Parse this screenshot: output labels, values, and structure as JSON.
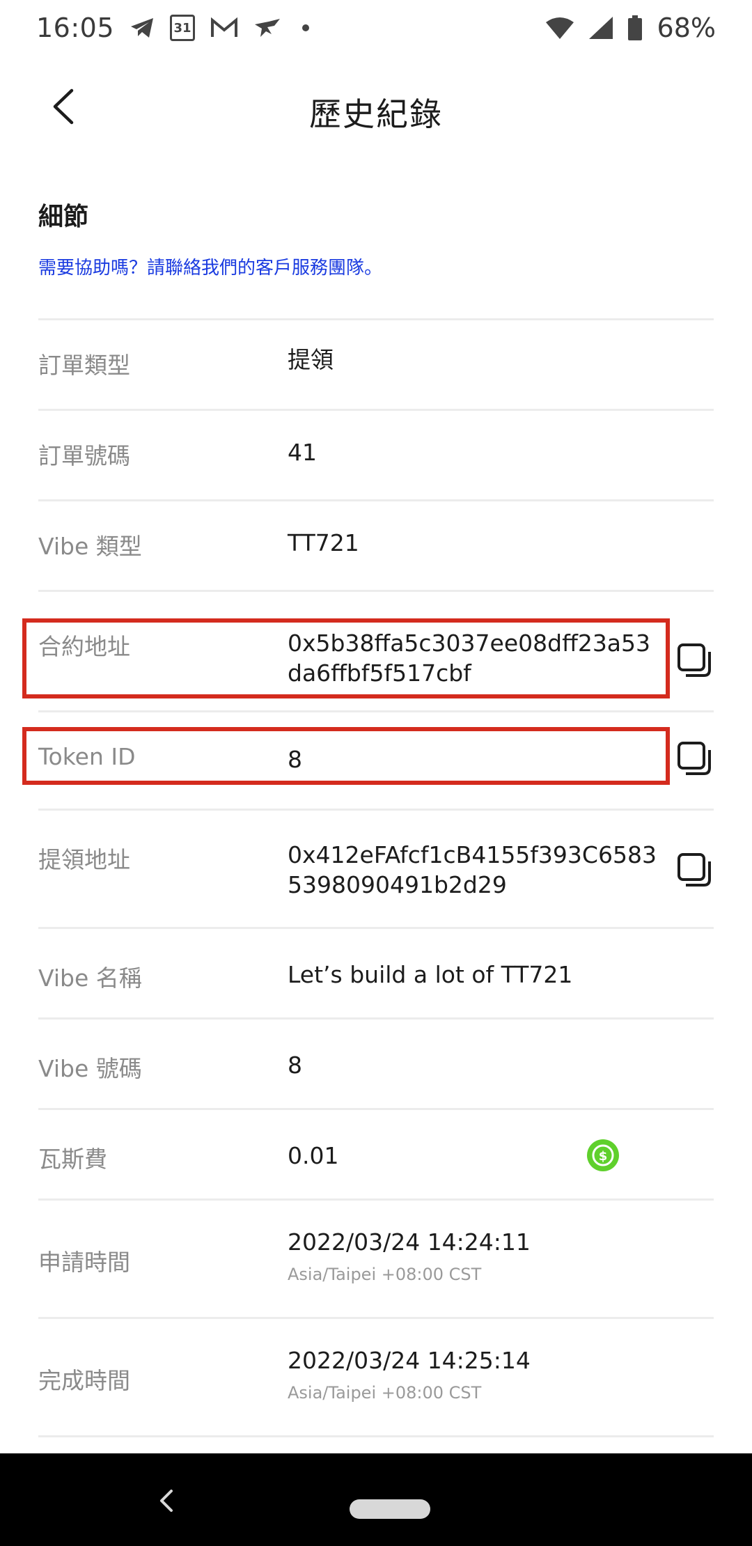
{
  "status_bar": {
    "time": "16:05",
    "calendar_day": "31",
    "battery": "68%",
    "left_icons": [
      "telegram-icon",
      "calendar-icon",
      "gmail-icon",
      "bird-icon",
      "dot-icon"
    ],
    "right_icons": [
      "wifi-icon",
      "signal-icon",
      "battery-icon"
    ]
  },
  "header": {
    "title": "歷史紀錄",
    "back_icon": "chevron-left-icon"
  },
  "section": {
    "title": "細節",
    "help_text": "需要協助嗎？請聯絡我們的客戶服務團隊。"
  },
  "details": {
    "order_type": {
      "label": "訂單類型",
      "value": "提領"
    },
    "order_number": {
      "label": "訂單號碼",
      "value": "41"
    },
    "vibe_type": {
      "label": "Vibe 類型",
      "value": "TT721"
    },
    "contract_address": {
      "label": "合約地址",
      "value_line1": "0x5b38ffa5c3037ee08dff23a53",
      "value_line2": "da6ffbf5f517cbf"
    },
    "token_id": {
      "label": "Token ID",
      "value": "8"
    },
    "withdraw_address": {
      "label": "提領地址",
      "value_line1": "0x412eFAfcf1cB4155f393C6583",
      "value_line2": "5398090491b2d29"
    },
    "vibe_name": {
      "label": "Vibe 名稱",
      "value": "Let’s build a lot of TT721"
    },
    "vibe_number": {
      "label": "Vibe 號碼",
      "value": "8"
    },
    "gas_fee": {
      "label": "瓦斯費",
      "value": "0.01"
    },
    "request_time": {
      "label": "申請時間",
      "value": "2022/03/24 14:24:11",
      "timezone": "Asia/Taipei +08:00 CST"
    },
    "complete_time": {
      "label": "完成時間",
      "value": "2022/03/24 14:25:14",
      "timezone": "Asia/Taipei +08:00 CST"
    }
  },
  "colors": {
    "link": "#1a3be0",
    "highlight": "#d42b1e",
    "gas_icon": "#5fd02c"
  },
  "nav_bar": {
    "icons": [
      "nav-back-icon",
      "home-pill-icon"
    ]
  }
}
